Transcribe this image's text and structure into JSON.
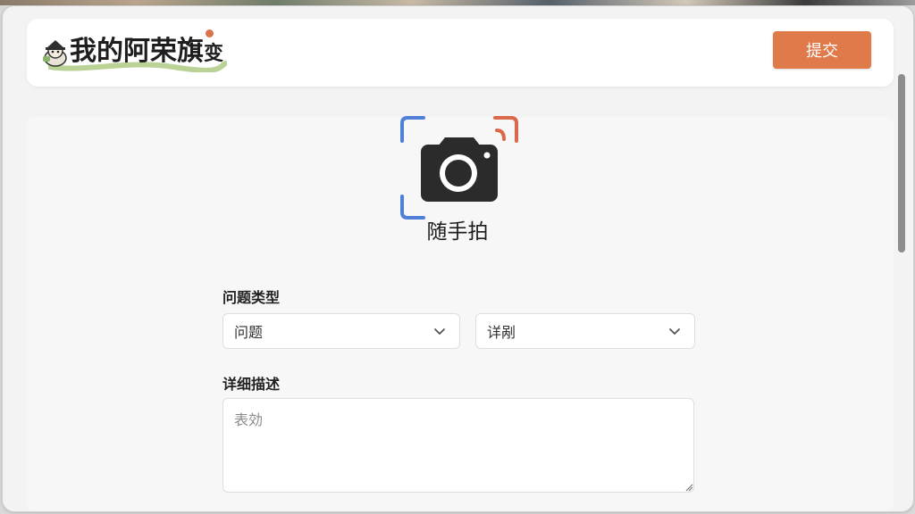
{
  "header": {
    "logo_text": "我的阿荣旗",
    "logo_suffix": "变",
    "submit_label": "提交",
    "accent_color": "#e07a4b"
  },
  "camera": {
    "icon": "camera-icon",
    "label": "随手拍",
    "corner_colors": {
      "blue": "#4f7fd6",
      "orange": "#d86a4a"
    }
  },
  "form": {
    "type_label": "问题类型",
    "type_select": {
      "value": "问题"
    },
    "detail_select": {
      "value": "详剐"
    },
    "desc_label": "详细描述",
    "desc_placeholder": "表効"
  }
}
